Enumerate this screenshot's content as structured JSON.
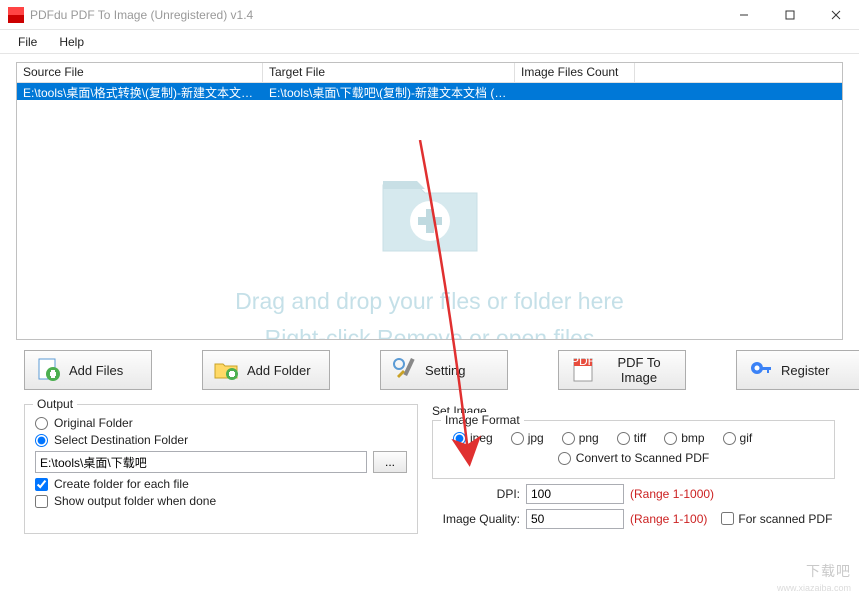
{
  "window": {
    "title": "PDFdu PDF To Image (Unregistered) v1.4"
  },
  "menu": {
    "file": "File",
    "help": "Help"
  },
  "filelist": {
    "headers": {
      "source": "Source File",
      "target": "Target File",
      "count": "Image Files Count"
    },
    "rows": [
      {
        "source": "E:\\tools\\桌面\\格式转换\\(复制)-新建文本文档 ...",
        "target": "E:\\tools\\桌面\\下载吧\\(复制)-新建文本文档 (2...",
        "count": ""
      }
    ],
    "hint1": "Drag and drop your files or folder here",
    "hint2": "Right-click Remove or open files"
  },
  "toolbar": {
    "add_files": "Add Files",
    "add_folder": "Add Folder",
    "setting": "Setting",
    "to_image": "PDF To Image",
    "register": "Register"
  },
  "output": {
    "legend": "Output",
    "original": "Original Folder",
    "select_dest": "Select Destination Folder",
    "path": "E:\\tools\\桌面\\下载吧",
    "browse": "...",
    "create_folder": "Create folder for each file",
    "show_folder": "Show output folder when done"
  },
  "setimage": {
    "legend": "Set Image",
    "format_legend": "Image Format",
    "formats": {
      "jpeg": "jpeg",
      "jpg": "jpg",
      "png": "png",
      "tiff": "tiff",
      "bmp": "bmp",
      "gif": "gif"
    },
    "convert_scanned": "Convert to Scanned PDF",
    "dpi_label": "DPI:",
    "dpi_value": "100",
    "dpi_range": "(Range 1-1000)",
    "quality_label": "Image Quality:",
    "quality_value": "50",
    "quality_range": "(Range 1-100)",
    "for_scanned": "For scanned PDF"
  },
  "watermark": {
    "main": "下载吧",
    "sub": "www.xiazaiba.com"
  }
}
